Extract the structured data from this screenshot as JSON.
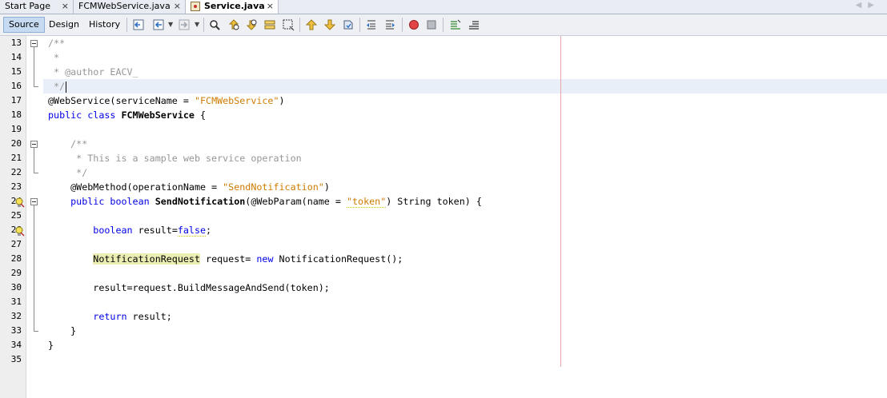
{
  "tabs": [
    {
      "label": "Start Page",
      "active": false
    },
    {
      "label": "FCMWebService.java",
      "active": false
    },
    {
      "label": "Service.java",
      "active": true
    }
  ],
  "tab_close": "×",
  "view_buttons": {
    "source": "Source",
    "design": "Design",
    "history": "History"
  },
  "editor": {
    "line_numbers": [
      "13",
      "14",
      "15",
      "16",
      "17",
      "18",
      "19",
      "20",
      "21",
      "22",
      "23",
      "24",
      "25",
      "26",
      "27",
      "28",
      "29",
      "30",
      "31",
      "32",
      "33",
      "34",
      "35"
    ]
  },
  "code": {
    "l13": "/**",
    "l14": " *",
    "l15a": " * @author EACV",
    "l15b": "_",
    "l16": " */",
    "l17a": "@WebService(serviceName = ",
    "l17b": "\"FCMWebService\"",
    "l17c": ")",
    "l18a": "public class ",
    "l18b": "FCMWebService",
    "l18c": " {",
    "l20": "    /**",
    "l21": "     * This is a sample web service operation",
    "l22": "     */",
    "l23a": "    @WebMethod(operationName = ",
    "l23b": "\"SendNotification\"",
    "l23c": ")",
    "l24a": "    public boolean ",
    "l24b": "SendNotification",
    "l24c": "(@WebParam(name = ",
    "l24d": "\"token\"",
    "l24e": ") String token) {",
    "l26a": "        boolean ",
    "l26b": "result=",
    "l26c": "false",
    "l26d": ";",
    "l28indent": "        ",
    "l28a": "NotificationRequest",
    "l28b": " request= ",
    "l28c": "new",
    "l28d": " NotificationRequest();",
    "l30": "        result=request.BuildMessageAndSend(token);",
    "l32a": "        return",
    "l32b": " result;",
    "l33": "    }",
    "l34": "}"
  },
  "colors": {
    "keyword": "#0000e6",
    "string": "#ce7b00",
    "comment": "#969696",
    "highlight": "#ecedb3",
    "margin_line": "#e8a6a6"
  }
}
